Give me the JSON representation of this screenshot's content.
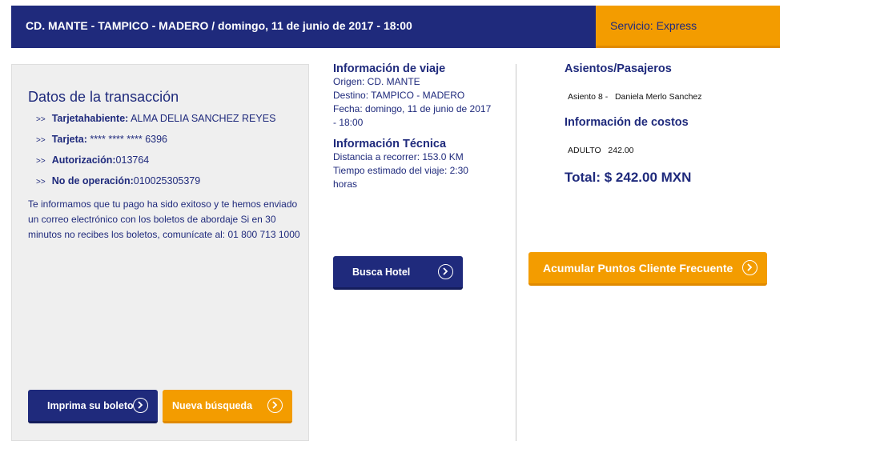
{
  "header": {
    "route": "CD. MANTE - TAMPICO - MADERO / domingo, 11 de junio de 2017 - 18:00",
    "service": "Servicio: Express"
  },
  "transaction": {
    "title": "Datos de la transacción",
    "arrow": ">>",
    "items": [
      {
        "label": "Tarjetahabiente:",
        "value": " ALMA DELIA SANCHEZ REYES"
      },
      {
        "label": "Tarjeta:",
        "value": " **** **** **** 6396"
      },
      {
        "label": "Autorización:",
        "value": "013764"
      },
      {
        "label": "No de operación:",
        "value": "010025305379"
      }
    ],
    "message": "Te informamos que tu pago ha sido exitoso y te hemos enviado un correo electrónico con los boletos de abordaje Si en 30 minutos no recibes los boletos, comunícate al: 01 800 713 1000",
    "print_button": "Imprima su boleto",
    "new_search_button": "Nueva búsqueda"
  },
  "trip": {
    "title": "Información de viaje",
    "origin": "Origen: CD. MANTE",
    "destination": "Destino: TAMPICO - MADERO",
    "date": "Fecha: domingo, 11 de junio de 2017 - 18:00"
  },
  "technical": {
    "title": "Información Técnica",
    "distance": "Distancia a recorrer: 153.0 KM",
    "time": "Tiempo estimado del viaje: 2:30 horas"
  },
  "hotel_button": "Busca Hotel",
  "seats": {
    "title": "Asientos/Pasajeros",
    "seat": "Asiento 8 -",
    "passenger": "Daniela Merlo Sanchez"
  },
  "costs": {
    "title": "Información de costos",
    "type": "ADULTO",
    "amount": "242.00",
    "total": "Total: $ 242.00 MXN"
  },
  "loyalty_button": "Acumular Puntos Cliente Frecuente",
  "colors": {
    "primary": "#1f2a7c",
    "accent": "#f39c00"
  }
}
